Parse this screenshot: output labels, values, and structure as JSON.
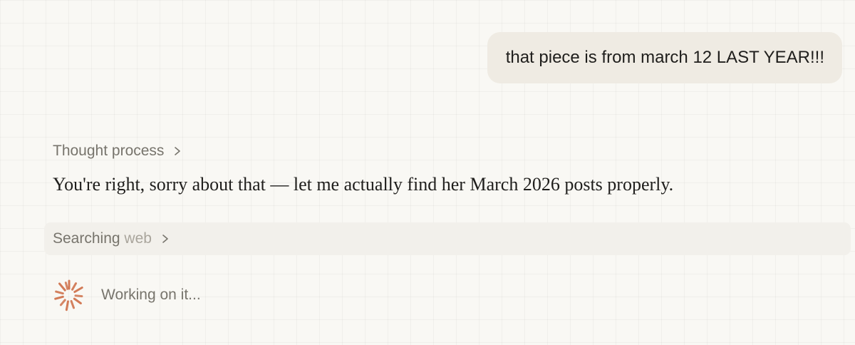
{
  "user_message": {
    "text": "that piece is from march 12 LAST YEAR!!!"
  },
  "assistant": {
    "thought_toggle_label": "Thought process",
    "reply_text": "You're right, sorry about that — let me actually find her March 2026 posts properly.",
    "tool_call": {
      "label_primary": "Searching ",
      "label_secondary": "web",
      "chevron_icon": "chevron-right-icon"
    },
    "status": {
      "icon": "spinner-icon",
      "text": "Working on it..."
    }
  },
  "colors": {
    "background": "#f9f8f4",
    "user_bubble": "#efebe3",
    "tool_row": "#f2f0eb",
    "spinner_accent": "#d27a56",
    "primary_text": "#1f1e1c",
    "muted_text": "#77746c"
  }
}
